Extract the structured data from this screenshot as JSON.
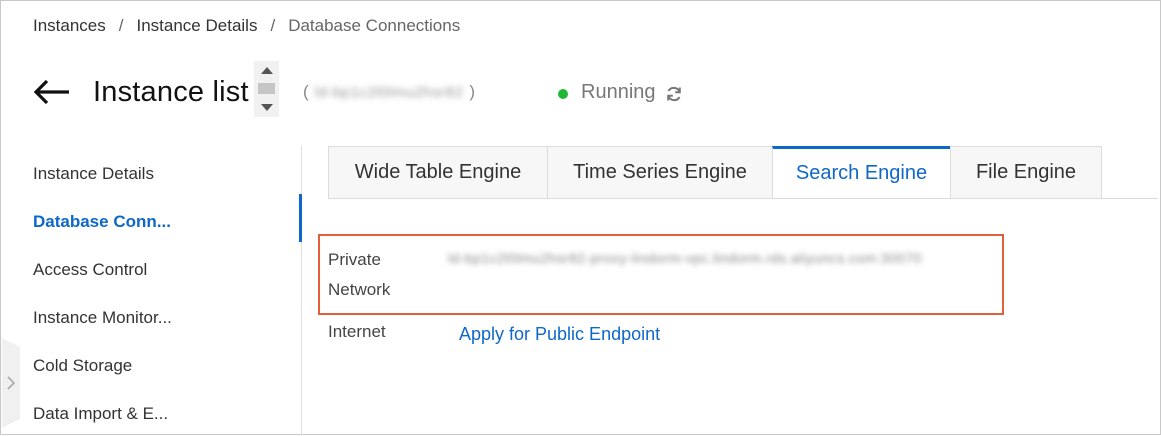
{
  "breadcrumb": {
    "items": [
      "Instances",
      "Instance Details",
      "Database Connections"
    ],
    "separator": "/"
  },
  "header": {
    "back_icon": "arrow-left-icon",
    "title": "Instance list",
    "instance_id_open": "(",
    "instance_id": "ld-bp1c2l0lmu2hsr82",
    "instance_id_close": ")",
    "status": "Running",
    "status_color": "#1fb834",
    "refresh_icon": "refresh-icon"
  },
  "sidebar": {
    "items": [
      {
        "label": "Instance Details",
        "active": false
      },
      {
        "label": "Database Conn...",
        "active": true
      },
      {
        "label": "Access Control",
        "active": false
      },
      {
        "label": "Instance Monitor...",
        "active": false
      },
      {
        "label": "Cold Storage",
        "active": false
      },
      {
        "label": "Data Import & E...",
        "active": false
      }
    ],
    "collapse_icon": "chevron-right-icon"
  },
  "tabs": [
    {
      "label": "Wide Table Engine",
      "active": false
    },
    {
      "label": "Time Series Engine",
      "active": false
    },
    {
      "label": "Search Engine",
      "active": true
    },
    {
      "label": "File Engine",
      "active": false
    }
  ],
  "endpoints": {
    "private": {
      "label_line1": "Private",
      "label_line2": "Network",
      "value": "ld-bp1c2l0lmu2hsr82-proxy-lindorm-vpc.lindorm.rds.aliyuncs.com:30070"
    },
    "internet": {
      "label": "Internet",
      "action": "Apply for Public Endpoint"
    }
  },
  "colors": {
    "accent": "#0f68c9",
    "highlight_border": "#e0603a"
  }
}
